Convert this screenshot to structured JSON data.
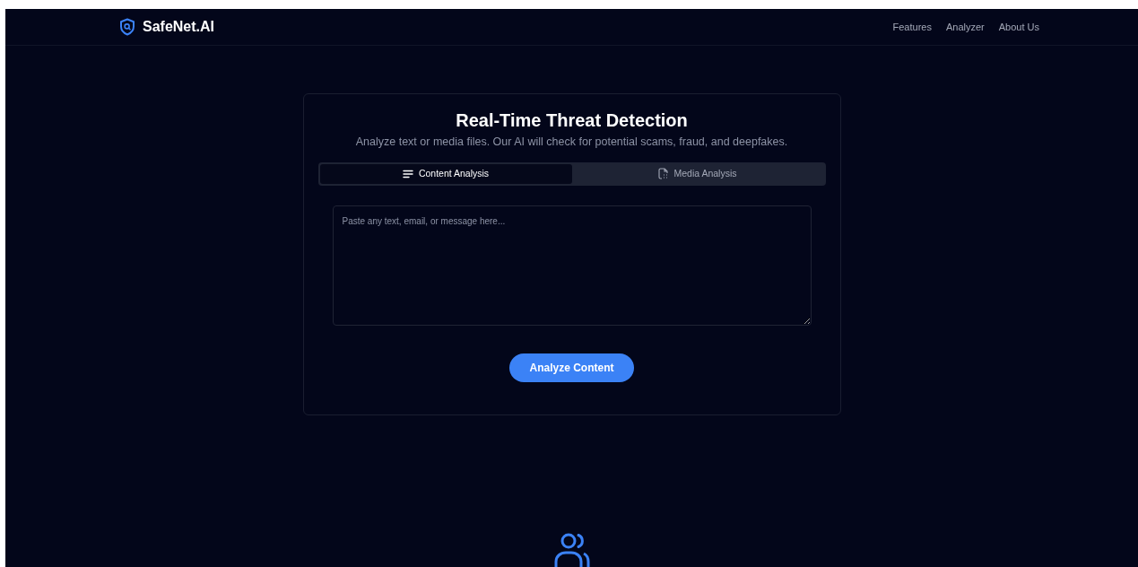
{
  "navbar": {
    "brand": "SafeNet.AI",
    "links": [
      {
        "label": "Features"
      },
      {
        "label": "Analyzer"
      },
      {
        "label": "About Us"
      }
    ]
  },
  "analyzer": {
    "title": "Real-Time Threat Detection",
    "subtitle": "Analyze text or media files. Our AI will check for potential scams, fraud, and deepfakes.",
    "tabs": [
      {
        "label": "Content Analysis",
        "kind": "text",
        "selected": true
      },
      {
        "label": "Media Analysis",
        "kind": "media",
        "selected": false
      }
    ],
    "input": {
      "placeholder": "Paste any text, email, or message here..."
    },
    "button": "Analyze Content"
  }
}
